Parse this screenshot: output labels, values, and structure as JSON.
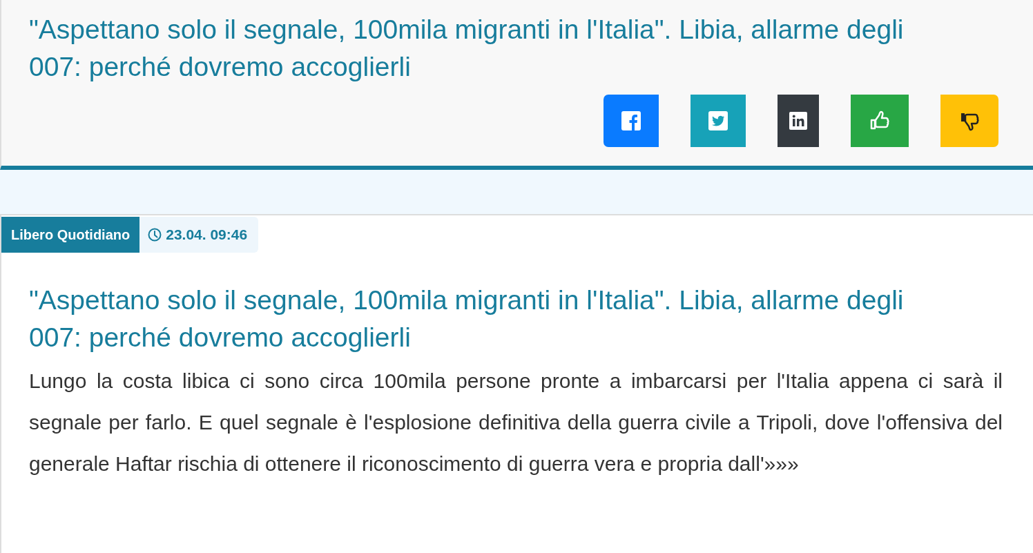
{
  "header": {
    "title": "\"Aspettano solo il segnale, 100mila migranti in l'Italia\". Libia, allarme degli 007: perché dovremo accoglierli",
    "buttons": [
      {
        "kind": "facebook"
      },
      {
        "kind": "twitter"
      },
      {
        "kind": "linkedin"
      },
      {
        "kind": "like"
      },
      {
        "kind": "dislike"
      }
    ]
  },
  "article": {
    "source": "Libero Quotidiano",
    "time": "23.04. 09:46",
    "title": "\"Aspettano solo il segnale, 100mila migranti in l'Italia\". Libia, allarme degli 007: perché dovremo accoglierli",
    "summary": "Lungo la costa libica ci sono circa 100mila persone pronte a imbarcarsi per l'Italia appena ci sarà il segnale per farlo. E quel segnale è l'esplosione definitiva della guerra civile a Tripoli, dove l'offensiva del generale Haftar rischia di ottenere il riconoscimento di guerra vera e propria dall'»»»"
  }
}
